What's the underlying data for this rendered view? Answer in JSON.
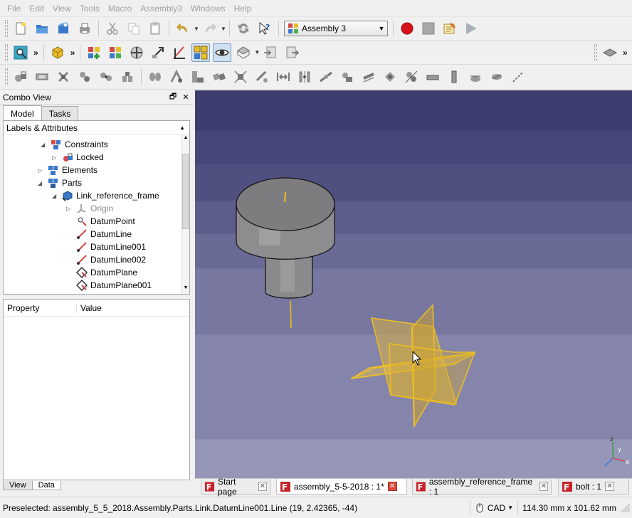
{
  "menu": [
    "File",
    "Edit",
    "View",
    "Tools",
    "Macro",
    "Assembly3",
    "Windows",
    "Help"
  ],
  "toolbar": {
    "workbench_combo": "Assembly 3",
    "workbench_icon": "assembly-workbench-icon",
    "overflow_glyph": "»"
  },
  "combo_view": {
    "title": "Combo View",
    "float_glyph": "🗗",
    "close_glyph": "✕",
    "tabs": [
      "Model",
      "Tasks"
    ],
    "tree_header": "Labels & Attributes",
    "tree": [
      {
        "label": "Constraints",
        "expander": "◢",
        "icon": "constraints-icon"
      },
      {
        "label": "Locked",
        "expander": "▷",
        "icon": "locked-constraint-icon"
      },
      {
        "label": "Elements",
        "expander": "▷",
        "icon": "elements-icon"
      },
      {
        "label": "Parts",
        "expander": "◢",
        "icon": "parts-icon"
      },
      {
        "label": "Link_reference_frame",
        "expander": "◢",
        "icon": "link-icon"
      },
      {
        "label": "Origin",
        "expander": "▷",
        "icon": "origin-icon",
        "muted": true
      },
      {
        "label": "DatumPoint",
        "expander": "",
        "icon": "datum-point-icon"
      },
      {
        "label": "DatumLine",
        "expander": "",
        "icon": "datum-line-icon"
      },
      {
        "label": "DatumLine001",
        "expander": "",
        "icon": "datum-line-icon"
      },
      {
        "label": "DatumLine002",
        "expander": "",
        "icon": "datum-line-icon"
      },
      {
        "label": "DatumPlane",
        "expander": "",
        "icon": "datum-plane-icon"
      },
      {
        "label": "DatumPlane001",
        "expander": "",
        "icon": "datum-plane-icon"
      }
    ],
    "property_columns": [
      "Property",
      "Value"
    ],
    "bottom_tabs": [
      "View",
      "Data"
    ]
  },
  "doc_tabs": [
    {
      "label": "Start page",
      "active": false
    },
    {
      "label": "assembly_5-5-2018 : 1*",
      "active": true
    },
    {
      "label": "assembly_reference_frame : 1",
      "active": false
    },
    {
      "label": "bolt : 1",
      "active": false
    }
  ],
  "doc_tab_close_glyph": "✕",
  "status": {
    "message": "Preselected: assembly_5_5_2018.Assembly.Parts.Link.DatumLine001.Line (19, 2.42365, -44)",
    "nav_style": "CAD",
    "dimensions": "114.30 mm x 101.62 mm"
  },
  "axis_labels": {
    "x": "x",
    "y": "y",
    "z": "z"
  },
  "colors": {
    "selection_yellow": "#f0c020",
    "bolt_gray": "#7f7f82",
    "view_bg_top": "#3d3d6f",
    "view_bg_bottom": "#9696b8",
    "record_red": "#d9111a"
  }
}
